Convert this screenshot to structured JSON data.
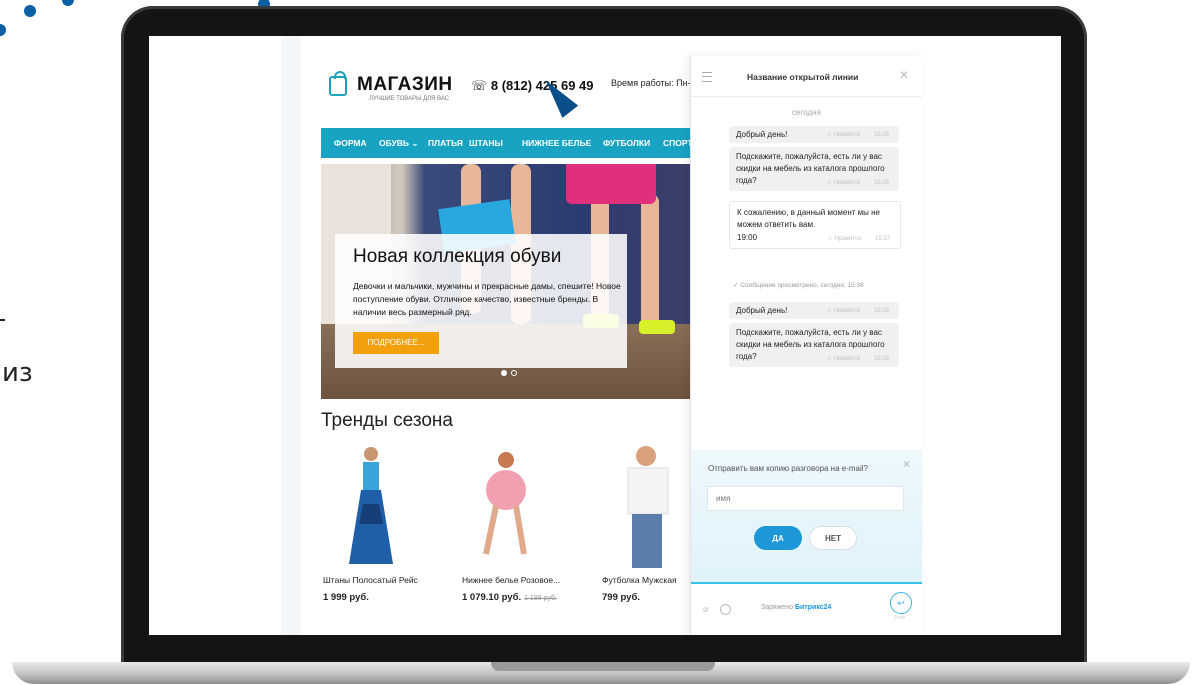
{
  "fragment": {
    "text": "из"
  },
  "colors": {
    "accent": "#19a3c2",
    "button_orange": "#f2a10d",
    "chat_blue": "#1d97d8",
    "dots": "#0b5fa5"
  },
  "site": {
    "logo_name": "МАГАЗИН",
    "logo_tagline": "ЛУЧШИЕ ТОВАРЫ ДЛЯ ВАС",
    "phone": "8 (812) 425 69 49",
    "phone_icon": "phone-icon",
    "hours": "Время работы: Пн-Вс",
    "nav": [
      "ФОРМА",
      "ОБУВЬ ⌄",
      "ПЛАТЬЯ",
      "ШТАНЫ",
      "НИЖНЕЕ БЕЛЬЕ",
      "ФУТБОЛКИ",
      "СПОРТ"
    ],
    "hero": {
      "title": "Новая коллекция обуви",
      "text": "Девочки и мальчики, мужчины и прекрасные дамы, спешите! Новое поступление обуви. Отличное качество, известные бренды. В наличии весь размерный ряд.",
      "button": "ПОДРОБНЕЕ..."
    },
    "trends_title": "Тренды сезона",
    "products": [
      {
        "name": "Штаны Полосатый Рейс",
        "price": "1 999 руб.",
        "old_price": ""
      },
      {
        "name": "Нижнее белье Розовое...",
        "price": "1 079.10 руб.",
        "old_price": "1 199 руб."
      },
      {
        "name": "Футболка Мужская",
        "price": "799 руб.",
        "old_price": ""
      }
    ]
  },
  "chat": {
    "title": "Название открытой линии",
    "date_label": "сегодня",
    "messages": [
      {
        "text": "Добрый день!",
        "like": "Нравится",
        "time": "15:36"
      },
      {
        "text": "Подскажите, пожалуйста, есть ли у вас скидки на мебель из каталога прошлого года?",
        "like": "Нравится",
        "time": "15:36"
      },
      {
        "text": "К сожалению, в данный момент мы не можем ответить вам.",
        "sub": "19:00",
        "like": "Нравится",
        "time": "15:37"
      },
      {
        "text": "Добрый день!",
        "like": "Нравится",
        "time": "15:39"
      },
      {
        "text": "Подскажите, пожалуйста, есть ли у вас скидки на мебель из каталога прошлого года?",
        "like": "Нравится",
        "time": "15:39"
      }
    ],
    "seen": "Сообщение просмотрено, сегодня, 15:38",
    "email_question": "Отправить вам копию разговора на e-mail?",
    "email_placeholder": "имя",
    "yes": "ДА",
    "no": "НЕТ",
    "powered_prefix": "Заряжено",
    "powered_brand": "Битрикс24",
    "send_label": "Enter"
  }
}
